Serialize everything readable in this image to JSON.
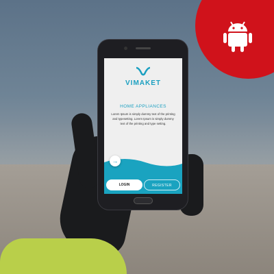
{
  "badge": {
    "icon": "android-icon",
    "color": "#d0121b"
  },
  "app": {
    "logo": "VIMAKET",
    "title": "HOME APPLIANCES",
    "description": "Lorem Ipsum is simply dummy text of the printing and typesetting. Lorem Ipsum is simply dummy text of the printing and type setting.",
    "next_icon": "arrow-right-icon",
    "login_label": "LOGIN",
    "register_label": "REGISTER",
    "accent": "#1a9fc0"
  }
}
